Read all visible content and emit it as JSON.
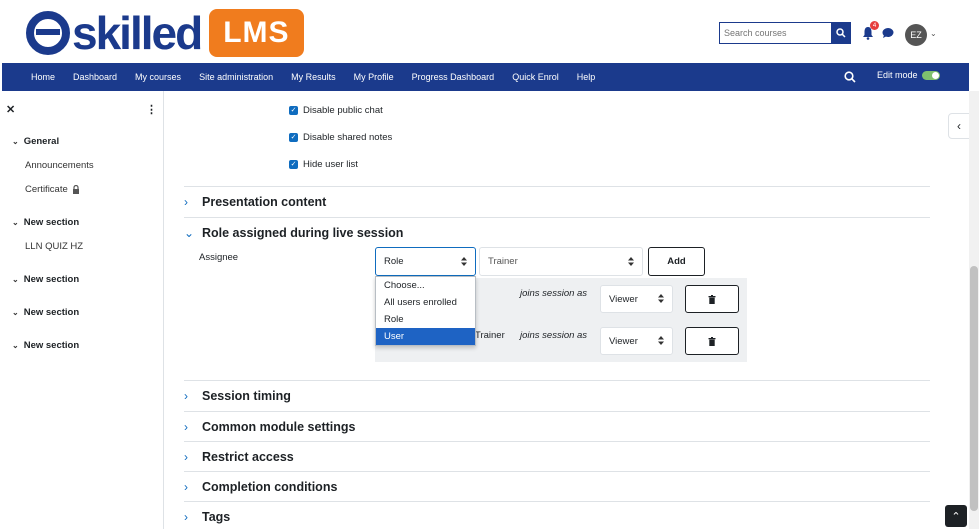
{
  "brand": {
    "word": "skilled",
    "lms": "LMS"
  },
  "search": {
    "placeholder": "Search courses"
  },
  "notifications": {
    "count": "4"
  },
  "user": {
    "initials": "EZ"
  },
  "nav": {
    "items": [
      "Home",
      "Dashboard",
      "My courses",
      "Site administration",
      "My Results",
      "My Profile",
      "Progress Dashboard",
      "Quick Enrol",
      "Help"
    ],
    "edit_mode_label": "Edit mode"
  },
  "sidebar": {
    "sections": [
      {
        "title": "General",
        "items": [
          "Announcements",
          "Certificate"
        ]
      },
      {
        "title": "New section",
        "items": [
          "LLN QUIZ HZ"
        ]
      },
      {
        "title": "New section",
        "items": []
      },
      {
        "title": "New section",
        "items": []
      },
      {
        "title": "New section",
        "items": []
      }
    ]
  },
  "checks": [
    {
      "label": "Disable public chat",
      "checked": true
    },
    {
      "label": "Disable shared notes",
      "checked": true
    },
    {
      "label": "Hide user list",
      "checked": true
    }
  ],
  "sections": {
    "presentation": "Presentation content",
    "role_assigned": "Role assigned during live session",
    "session_timing": "Session timing",
    "common_module": "Common module settings",
    "restrict": "Restrict access",
    "completion": "Completion conditions",
    "tags": "Tags"
  },
  "assignee": {
    "label": "Assignee",
    "type_value": "Role",
    "target_value": "Trainer",
    "add_label": "Add",
    "dropdown_options": [
      "Choose...",
      "All users enrolled",
      "Role",
      "User"
    ],
    "dropdown_selected": "User"
  },
  "assignments": [
    {
      "name": "",
      "joins": "joins session as",
      "role": "Viewer"
    },
    {
      "name": "Trainer",
      "joins": "joins session as",
      "role": "Viewer"
    }
  ]
}
